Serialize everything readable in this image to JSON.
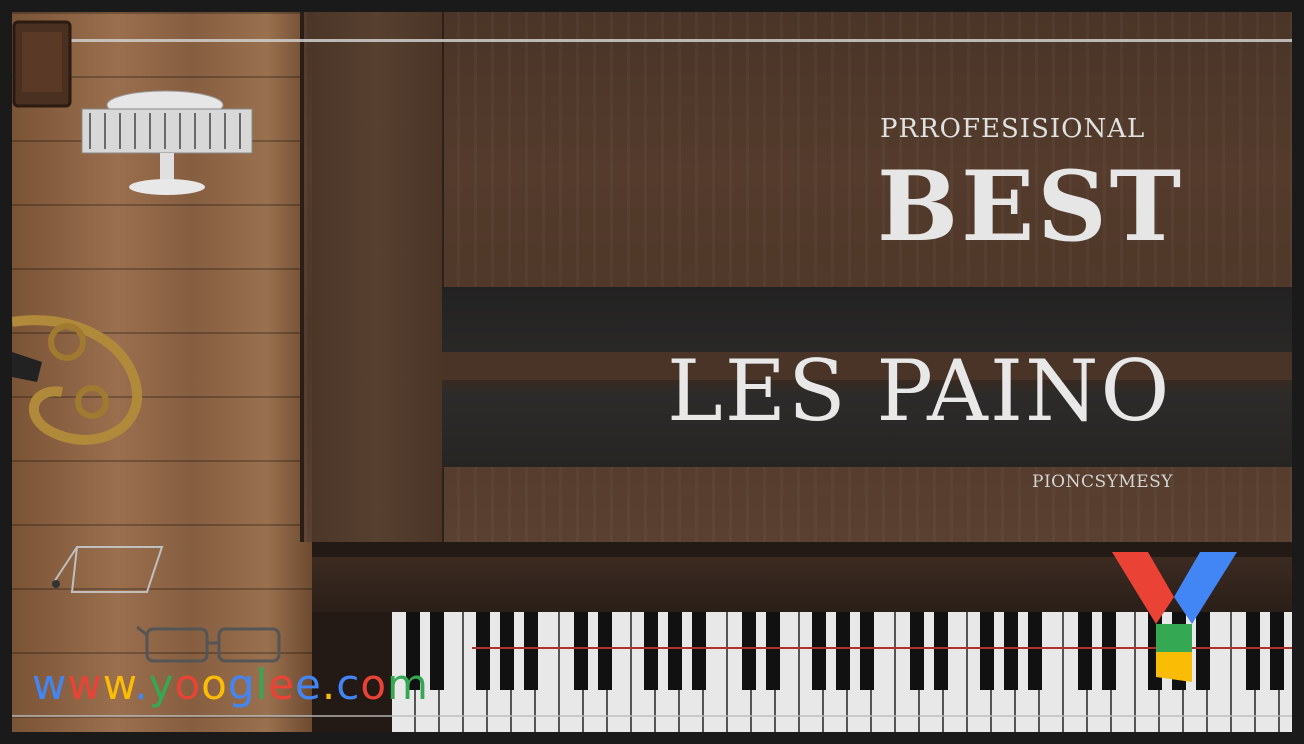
{
  "image": {
    "headline_top": "PRROFESISIONAL",
    "headline_main": "BEST",
    "headline_sub": "LES PAINO",
    "tagline": "PIONCSYMESY",
    "watermark_url": [
      "w",
      "w",
      "w",
      ".",
      "y",
      "o",
      "o",
      "g",
      "l",
      "e",
      "e",
      ".",
      "c",
      "o",
      "m"
    ],
    "watermark_colors": [
      "#4285F4",
      "#EA4335",
      "#FBBC05",
      "#4285F4",
      "#34A853",
      "#EA4335",
      "#FBBC05",
      "#4285F4",
      "#34A853",
      "#EA4335",
      "#4285F4",
      "#FBBC05",
      "#4285F4",
      "#EA4335",
      "#34A853"
    ],
    "logo_icon": "y-logo-icon"
  }
}
